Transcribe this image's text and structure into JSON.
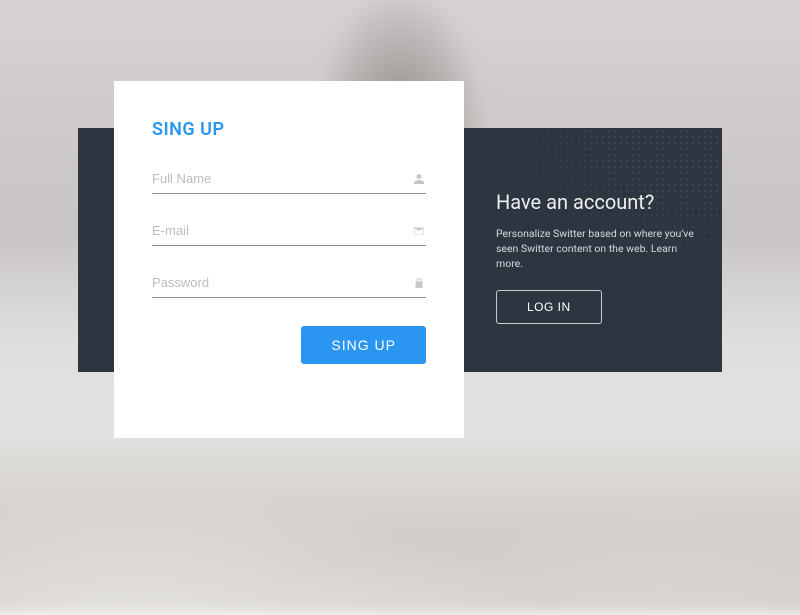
{
  "colors": {
    "accent": "#2b95f2",
    "dark_panel": "#2c3540"
  },
  "card": {
    "title": "SING UP",
    "fields": {
      "full_name": {
        "placeholder": "Full Name",
        "value": ""
      },
      "email": {
        "placeholder": "E-mail",
        "value": ""
      },
      "password": {
        "placeholder": "Password",
        "value": ""
      }
    },
    "submit_label": "SING UP"
  },
  "promo": {
    "heading": "Have an account?",
    "body": "Personalize Switter based on where you've seen Switter content on the web. Learn more.",
    "login_label": "LOG IN"
  }
}
